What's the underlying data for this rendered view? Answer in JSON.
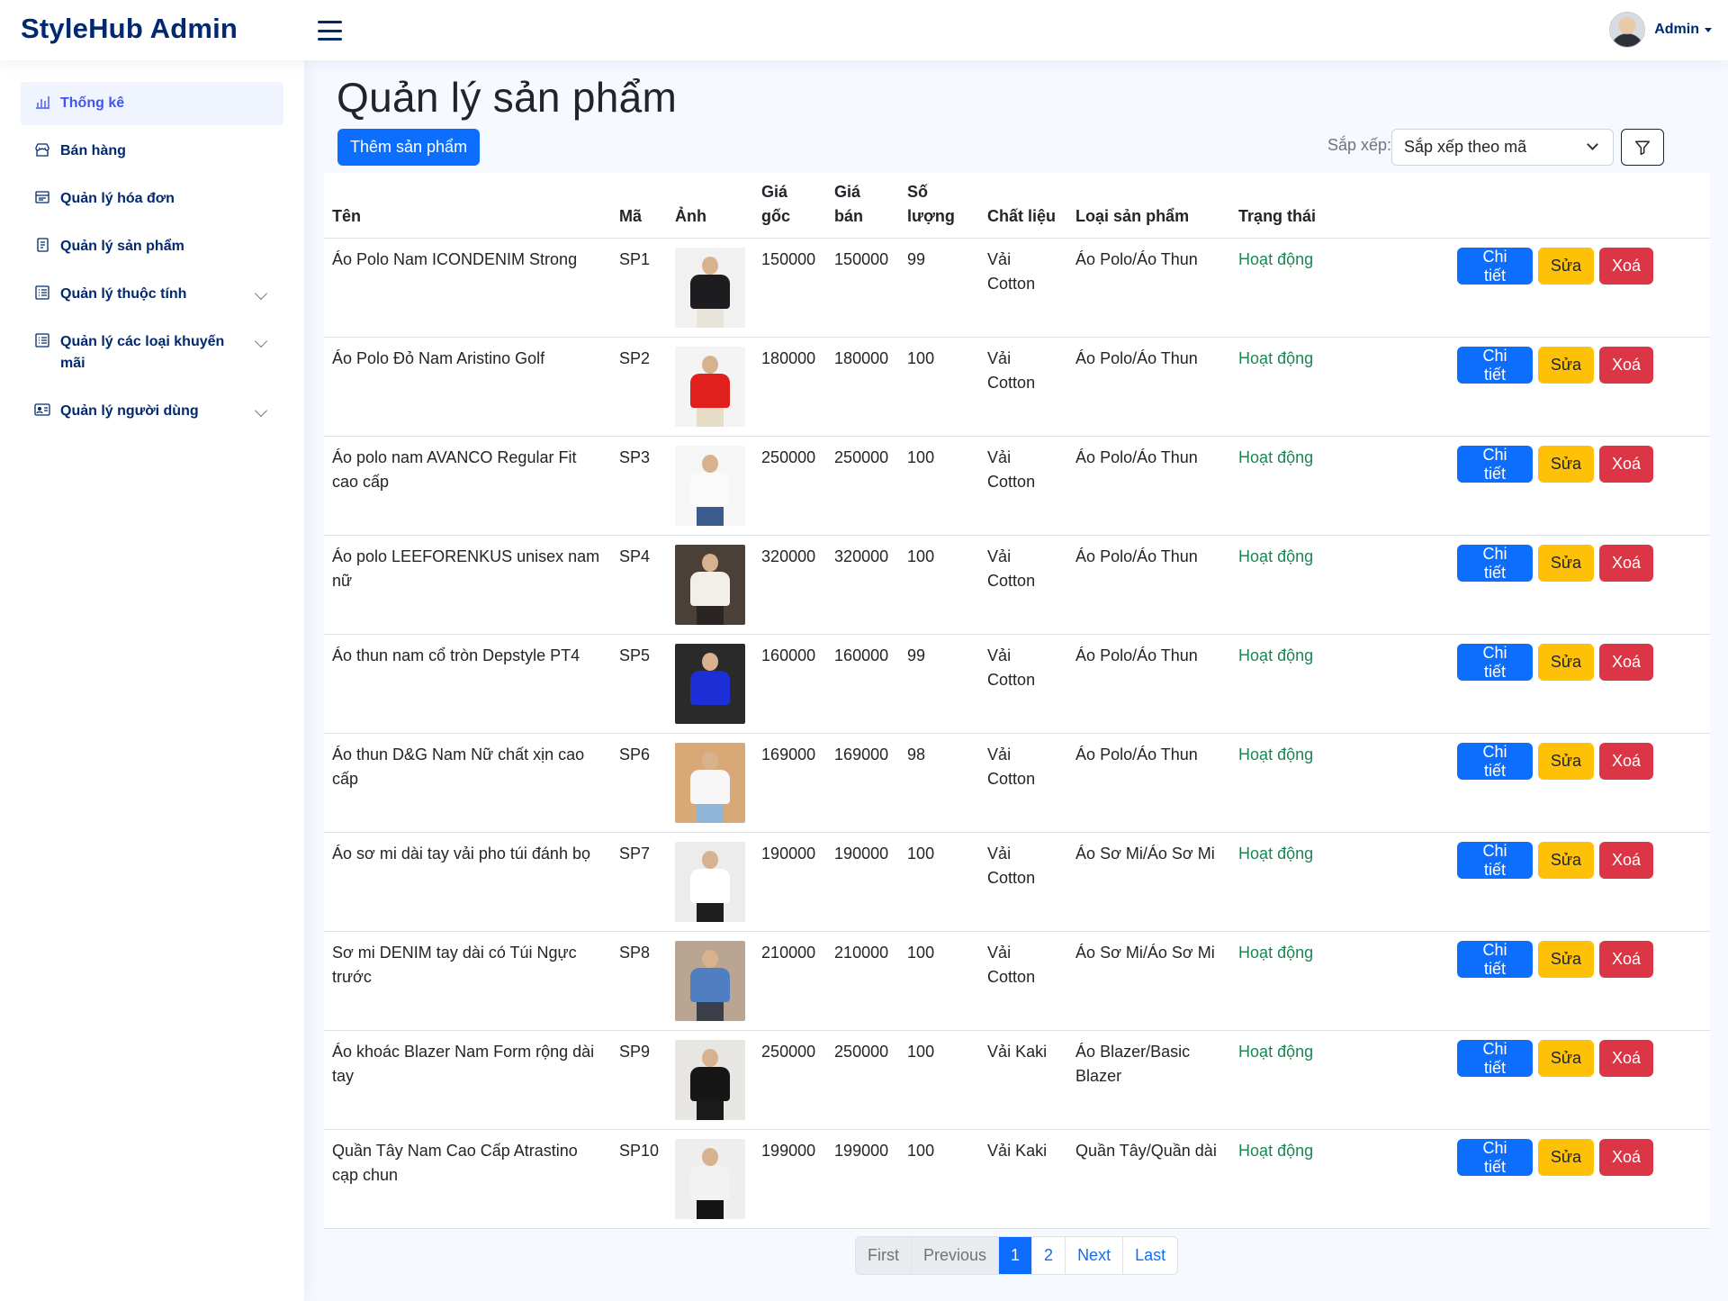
{
  "app": {
    "brand": "StyleHub Admin",
    "user_name": "Admin"
  },
  "sidebar": {
    "items": [
      {
        "label": "Thống kê",
        "icon": "bar-chart-icon",
        "active": true,
        "expandable": false
      },
      {
        "label": "Bán hàng",
        "icon": "shop-icon",
        "active": false,
        "expandable": false
      },
      {
        "label": "Quản lý hóa đơn",
        "icon": "receipt-icon",
        "active": false,
        "expandable": false
      },
      {
        "label": "Quản lý sản phẩm",
        "icon": "document-icon",
        "active": false,
        "expandable": false
      },
      {
        "label": "Quản lý thuộc tính",
        "icon": "list-icon",
        "active": false,
        "expandable": true
      },
      {
        "label": "Quản lý các loại khuyến mãi",
        "icon": "list-icon",
        "active": false,
        "expandable": true
      },
      {
        "label": "Quản lý người dùng",
        "icon": "person-card-icon",
        "active": false,
        "expandable": true
      }
    ]
  },
  "main": {
    "title": "Quản lý sản phẩm",
    "add_button": "Thêm sản phẩm",
    "sort_label": "Sắp xếp:",
    "sort_value": "Sắp xếp theo mã",
    "columns": [
      "Tên",
      "Mã",
      "Ảnh",
      "Giá gốc",
      "Giá bán",
      "Số lượng",
      "Chất liệu",
      "Loại sản phẩm",
      "Trạng thái",
      ""
    ],
    "actions": {
      "detail": "Chi tiết",
      "edit": "Sửa",
      "delete": "Xoá"
    },
    "rows": [
      {
        "name": "Áo Polo Nam ICONDENIM Strong",
        "code": "SP1",
        "price_orig": "150000",
        "price_sale": "150000",
        "qty": "99",
        "material": "Vải Cotton",
        "type": "Áo Polo/Áo Thun",
        "status": "Hoạt động",
        "img": {
          "bg": "#f1f1f1",
          "shirt": "#1d1d1f",
          "legs": "#e9e4da"
        }
      },
      {
        "name": "Áo Polo Đỏ Nam Aristino Golf",
        "code": "SP2",
        "price_orig": "180000",
        "price_sale": "180000",
        "qty": "100",
        "material": "Vải Cotton",
        "type": "Áo Polo/Áo Thun",
        "status": "Hoạt động",
        "img": {
          "bg": "#f4f4f4",
          "shirt": "#e0201c",
          "legs": "#e7dcc8"
        }
      },
      {
        "name": "Áo polo nam AVANCO Regular Fit cao cấp",
        "code": "SP3",
        "price_orig": "250000",
        "price_sale": "250000",
        "qty": "100",
        "material": "Vải Cotton",
        "type": "Áo Polo/Áo Thun",
        "status": "Hoạt động",
        "img": {
          "bg": "#f6f6f6",
          "shirt": "#fafafa",
          "legs": "#3b5b8f"
        }
      },
      {
        "name": "Áo polo LEEFORENKUS unisex nam nữ",
        "code": "SP4",
        "price_orig": "320000",
        "price_sale": "320000",
        "qty": "100",
        "material": "Vải Cotton",
        "type": "Áo Polo/Áo Thun",
        "status": "Hoạt động",
        "img": {
          "bg": "#4a4038",
          "shirt": "#f2efe8",
          "legs": "#2a2522"
        }
      },
      {
        "name": "Áo thun nam cổ tròn Depstyle PT4",
        "code": "SP5",
        "price_orig": "160000",
        "price_sale": "160000",
        "qty": "99",
        "material": "Vải Cotton",
        "type": "Áo Polo/Áo Thun",
        "status": "Hoạt động",
        "img": {
          "bg": "#2a2a2a",
          "shirt": "#1c2fd6",
          "legs": "#2a2a2a"
        }
      },
      {
        "name": "Áo thun D&G Nam Nữ chất xịn cao cấp",
        "code": "SP6",
        "price_orig": "169000",
        "price_sale": "169000",
        "qty": "98",
        "material": "Vải Cotton",
        "type": "Áo Polo/Áo Thun",
        "status": "Hoạt động",
        "img": {
          "bg": "#d9a877",
          "shirt": "#f7f7f7",
          "legs": "#8fb6d9"
        }
      },
      {
        "name": "Áo sơ mi dài tay vải pho túi đánh bọ",
        "code": "SP7",
        "price_orig": "190000",
        "price_sale": "190000",
        "qty": "100",
        "material": "Vải Cotton",
        "type": "Áo Sơ Mi/Áo Sơ Mi",
        "status": "Hoạt động",
        "img": {
          "bg": "#ececec",
          "shirt": "#ffffff",
          "legs": "#1e1e1e"
        }
      },
      {
        "name": "Sơ mi DENIM tay dài có Túi Ngực trước",
        "code": "SP8",
        "price_orig": "210000",
        "price_sale": "210000",
        "qty": "100",
        "material": "Vải Cotton",
        "type": "Áo Sơ Mi/Áo Sơ Mi",
        "status": "Hoạt động",
        "img": {
          "bg": "#b9a592",
          "shirt": "#4f7fc0",
          "legs": "#3a3f4a"
        }
      },
      {
        "name": "Áo khoác Blazer Nam Form rộng dài tay",
        "code": "SP9",
        "price_orig": "250000",
        "price_sale": "250000",
        "qty": "100",
        "material": "Vải Kaki",
        "type": "Áo Blazer/Basic Blazer",
        "status": "Hoạt động",
        "img": {
          "bg": "#e8e6e3",
          "shirt": "#161616",
          "legs": "#1a1a1a"
        }
      },
      {
        "name": "Quần Tây Nam Cao Cấp Atrastino cạp chun",
        "code": "SP10",
        "price_orig": "199000",
        "price_sale": "199000",
        "qty": "100",
        "material": "Vải Kaki",
        "type": "Quần Tây/Quần dài",
        "status": "Hoạt động",
        "img": {
          "bg": "#eeeeee",
          "shirt": "#f2f2f2",
          "legs": "#141414"
        }
      }
    ]
  },
  "pagination": {
    "first": "First",
    "previous": "Previous",
    "pages": [
      "1",
      "2"
    ],
    "current": "1",
    "next": "Next",
    "last": "Last"
  },
  "colors": {
    "brand": "#012970",
    "primary": "#0d6efd",
    "warning": "#ffc107",
    "danger": "#dc3545",
    "success": "#198754"
  }
}
